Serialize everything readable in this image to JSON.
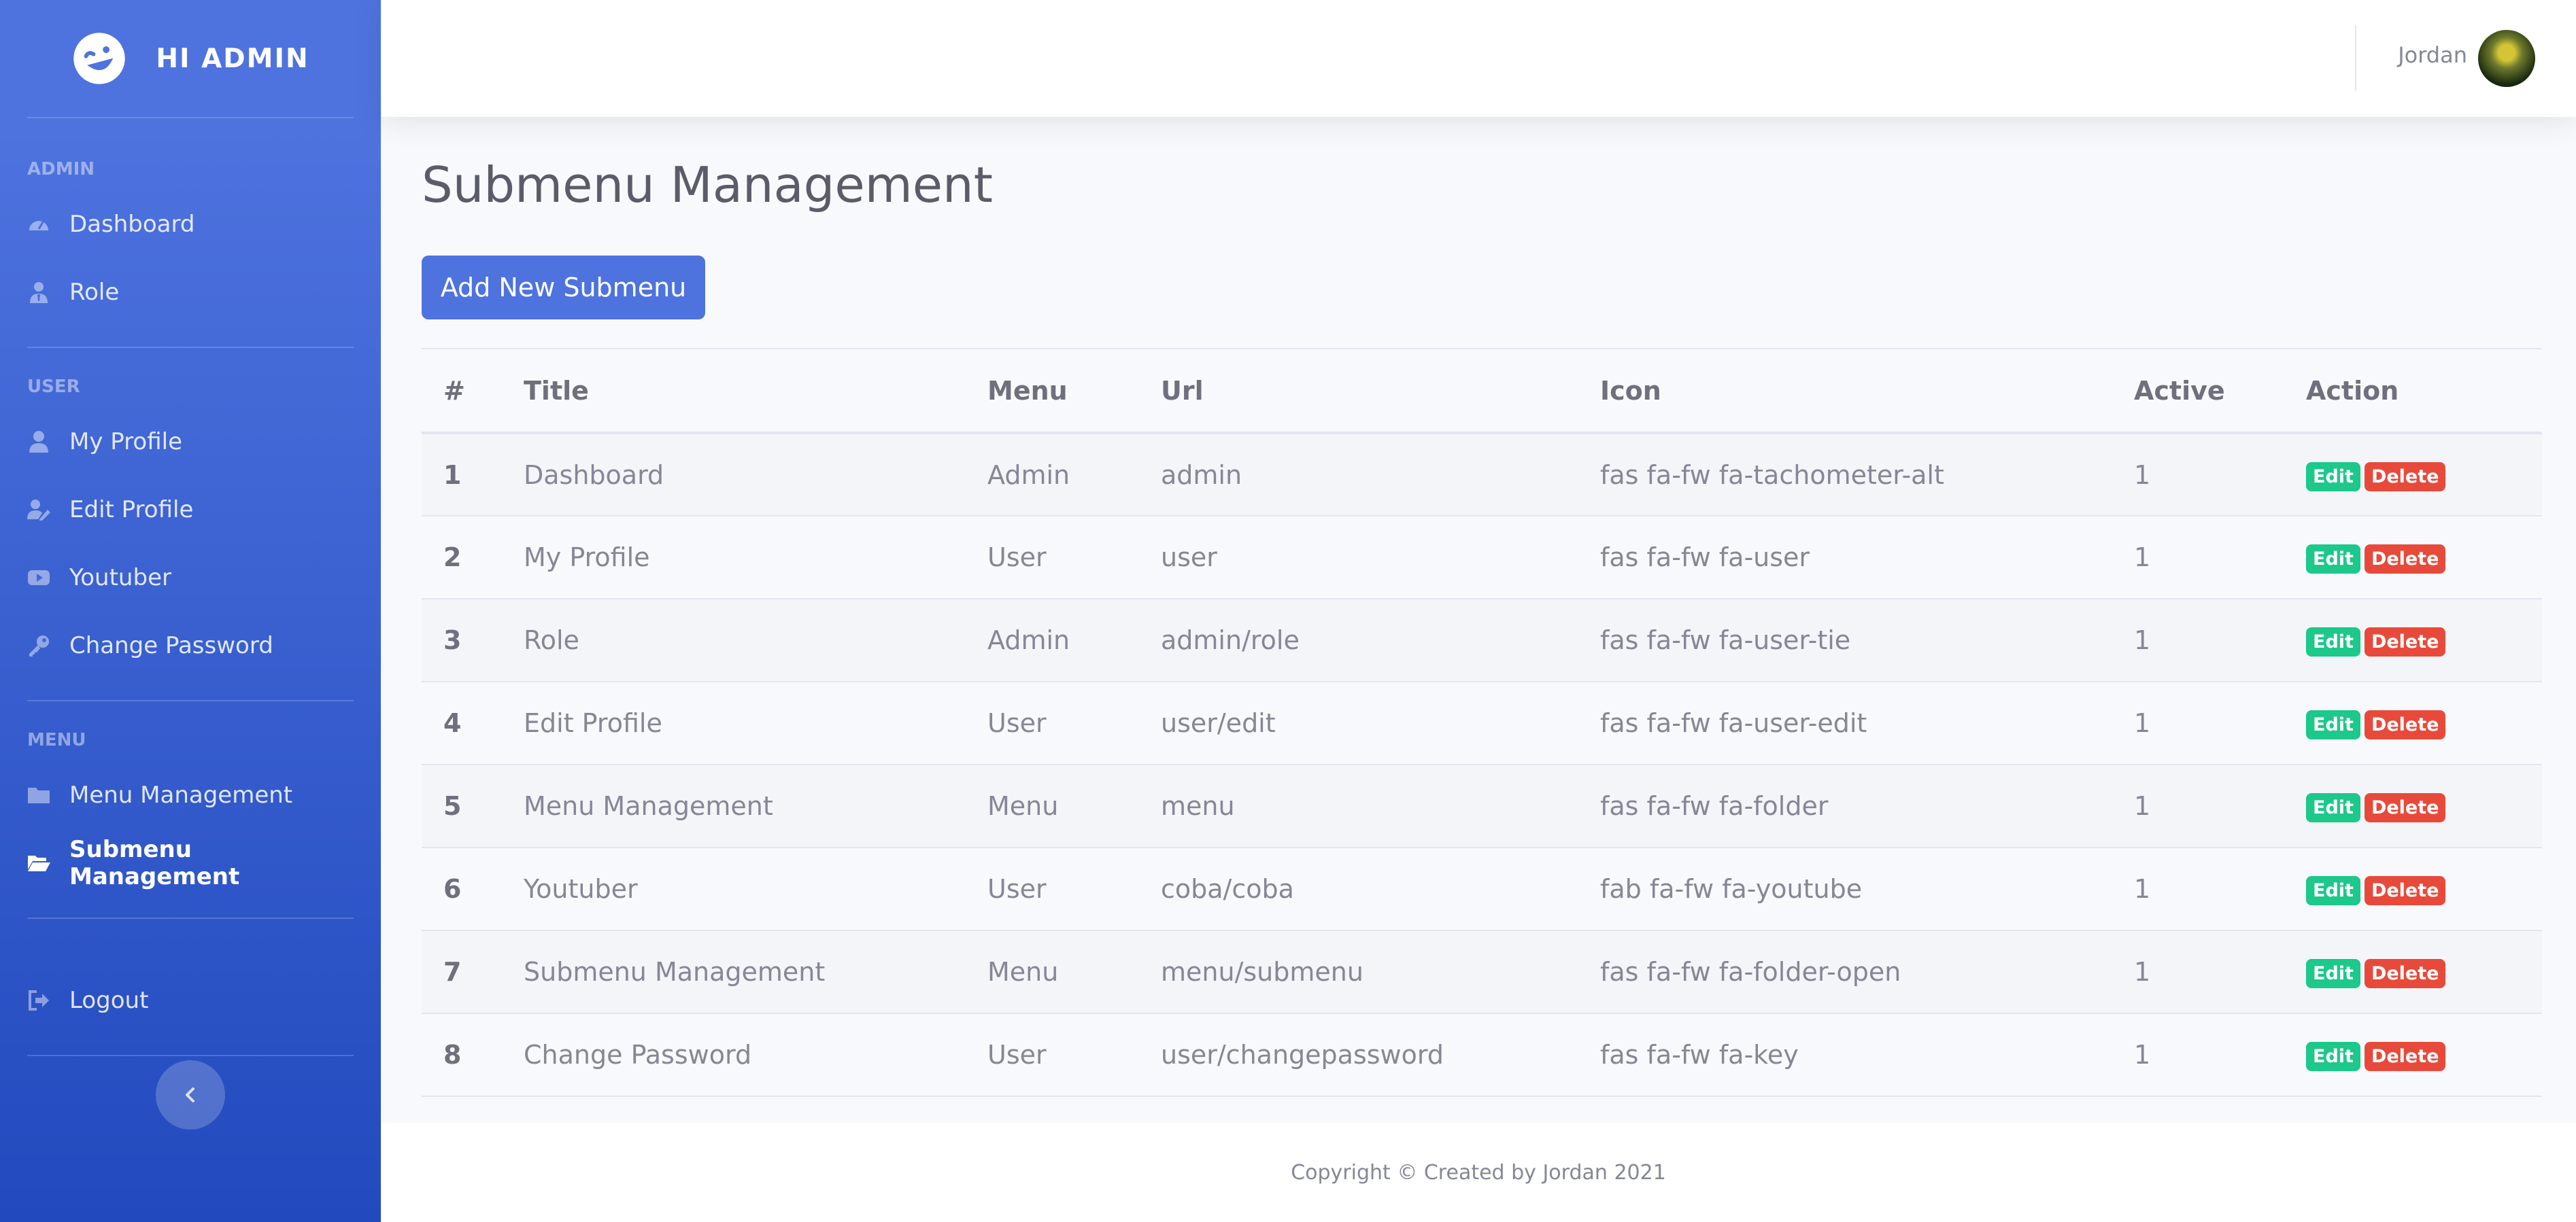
{
  "brand": {
    "title": "HI ADMIN",
    "icon": "laugh-wink-icon"
  },
  "sidebar": {
    "sections": [
      {
        "heading": "Admin",
        "items": [
          {
            "label": "Dashboard",
            "icon": "tachometer-icon",
            "active": false
          },
          {
            "label": "Role",
            "icon": "user-tie-icon",
            "active": false
          }
        ]
      },
      {
        "heading": "User",
        "items": [
          {
            "label": "My Profile",
            "icon": "user-icon",
            "active": false
          },
          {
            "label": "Edit Profile",
            "icon": "user-edit-icon",
            "active": false
          },
          {
            "label": "Youtuber",
            "icon": "youtube-icon",
            "active": false
          },
          {
            "label": "Change Password",
            "icon": "key-icon",
            "active": false
          }
        ]
      },
      {
        "heading": "Menu",
        "items": [
          {
            "label": "Menu Management",
            "icon": "folder-icon",
            "active": false
          },
          {
            "label": "Submenu Management",
            "icon": "folder-open-icon",
            "active": true
          }
        ]
      }
    ],
    "logout_label": "Logout"
  },
  "topbar": {
    "user_name": "Jordan"
  },
  "main": {
    "title": "Submenu Management",
    "add_button_label": "Add New Submenu"
  },
  "table": {
    "headers": [
      "#",
      "Title",
      "Menu",
      "Url",
      "Icon",
      "Active",
      "Action"
    ],
    "rows": [
      {
        "num": "1",
        "title": "Dashboard",
        "menu": "Admin",
        "url": "admin",
        "icon": "fas fa-fw fa-tachometer-alt",
        "active": "1"
      },
      {
        "num": "2",
        "title": "My Profile",
        "menu": "User",
        "url": "user",
        "icon": "fas fa-fw fa-user",
        "active": "1"
      },
      {
        "num": "3",
        "title": "Role",
        "menu": "Admin",
        "url": "admin/role",
        "icon": "fas fa-fw fa-user-tie",
        "active": "1"
      },
      {
        "num": "4",
        "title": "Edit Profile",
        "menu": "User",
        "url": "user/edit",
        "icon": "fas fa-fw fa-user-edit",
        "active": "1"
      },
      {
        "num": "5",
        "title": "Menu Management",
        "menu": "Menu",
        "url": "menu",
        "icon": "fas fa-fw fa-folder",
        "active": "1"
      },
      {
        "num": "6",
        "title": "Youtuber",
        "menu": "User",
        "url": "coba/coba",
        "icon": "fab fa-fw fa-youtube",
        "active": "1"
      },
      {
        "num": "7",
        "title": "Submenu Management",
        "menu": "Menu",
        "url": "menu/submenu",
        "icon": "fas fa-fw fa-folder-open",
        "active": "1"
      },
      {
        "num": "8",
        "title": "Change Password",
        "menu": "User",
        "url": "user/changepassword",
        "icon": "fas fa-fw fa-key",
        "active": "1"
      }
    ],
    "edit_label": "Edit",
    "delete_label": "Delete"
  },
  "footer": {
    "text": "Copyright © Created by Jordan 2021"
  },
  "colors": {
    "primary": "#4e73df",
    "success": "#1cc88a",
    "danger": "#e74a3b"
  }
}
